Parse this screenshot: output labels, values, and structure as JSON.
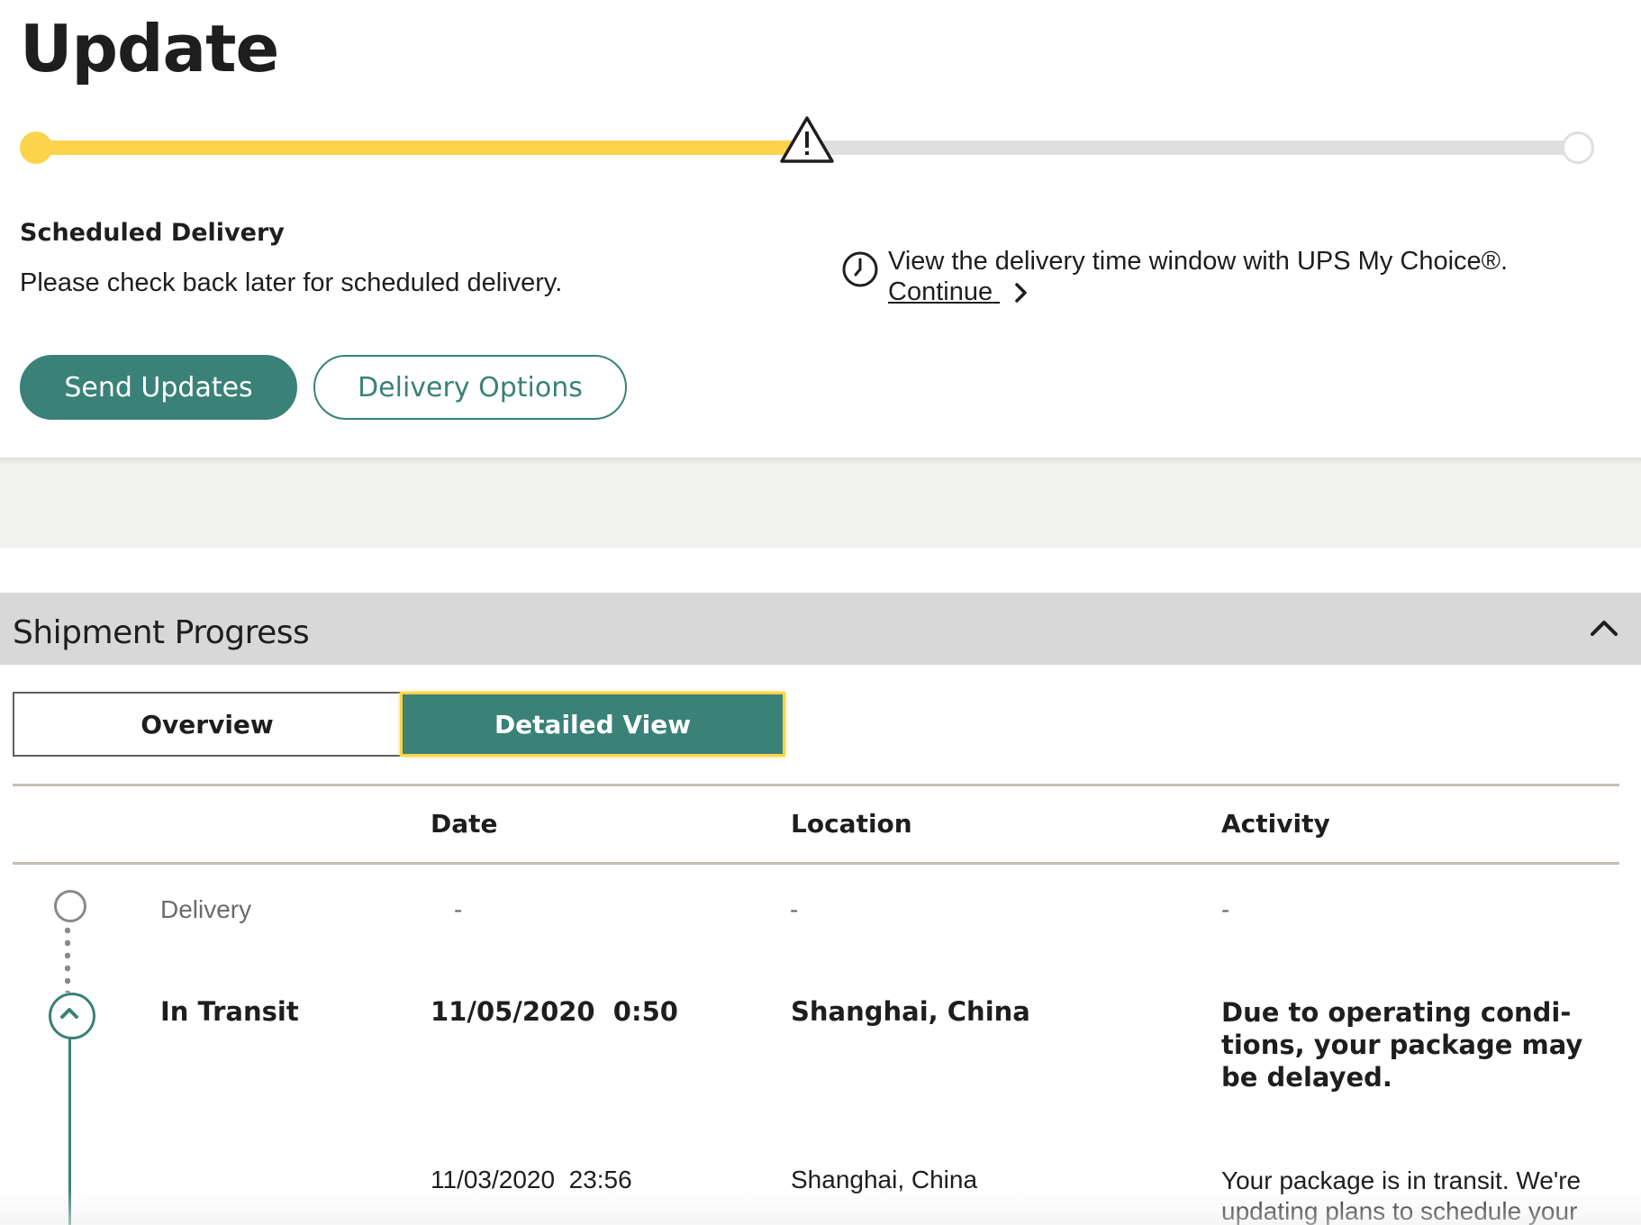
{
  "header": {
    "title": "Update"
  },
  "tracker": {
    "progress_fraction": 0.5,
    "fill_color": "#fbd44b",
    "status_icon": "warning-triangle-icon"
  },
  "scheduled": {
    "title": "Scheduled Delivery",
    "message": "Please check back later for scheduled delivery."
  },
  "my_choice": {
    "icon": "clock-icon",
    "text": "View the delivery time window with UPS My Choice®.",
    "link_label": "Continue"
  },
  "actions": {
    "send_updates": "Send Updates",
    "delivery_options": "Delivery Options"
  },
  "shipment_progress": {
    "title": "Shipment Progress",
    "tabs": [
      {
        "label": "Overview",
        "selected": false
      },
      {
        "label": "Detailed View",
        "selected": true
      }
    ],
    "columns": {
      "date": "Date",
      "location": "Location",
      "activity": "Activity"
    },
    "rows": [
      {
        "milestone": "Delivery",
        "date": "-",
        "location": "-",
        "activity": "-"
      },
      {
        "milestone": "In Transit",
        "date": "11/05/2020  0:50",
        "location": "Shanghai, China",
        "activity": "Due to operating condi-tions, your package may be delayed."
      },
      {
        "milestone": "",
        "date": "11/03/2020  23:56",
        "location": "Shanghai, China",
        "activity": "Your package is in transit. We're updating plans to schedule your"
      }
    ]
  },
  "colors": {
    "accent": "#3a8178",
    "highlight": "#fbd44b",
    "header_band": "#d8d8d8"
  }
}
